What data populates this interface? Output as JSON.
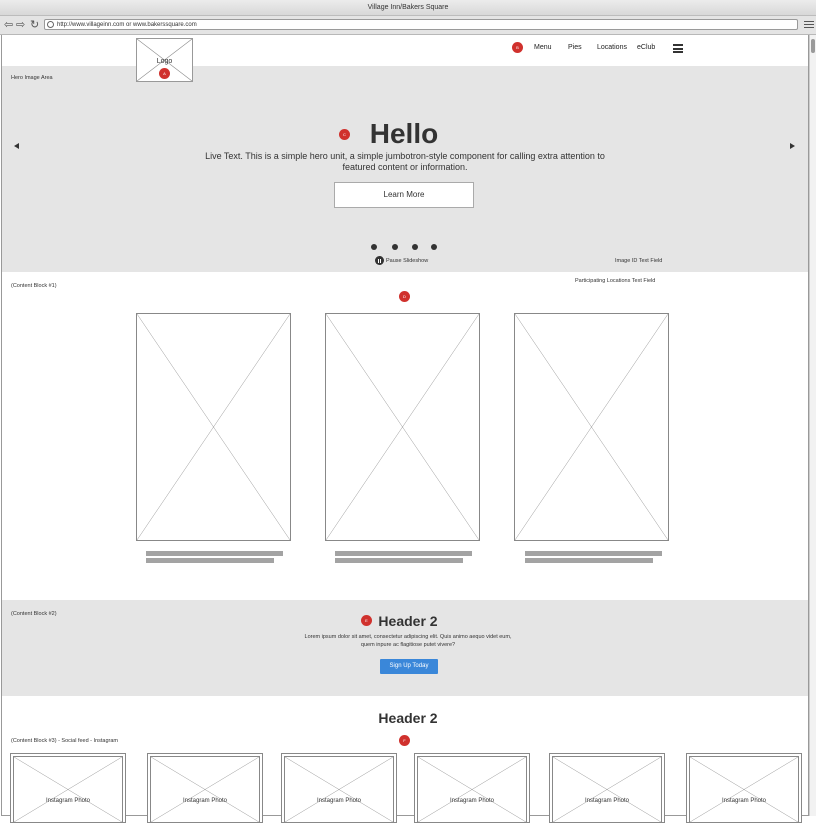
{
  "window": {
    "title": "Village Inn/Bakers Square"
  },
  "toolbar": {
    "back": "⇦",
    "forward": "⇨",
    "reload": "↻",
    "url": "http://www.villageinn.com or www.bakerssquare.com"
  },
  "header": {
    "logo_label": "Logo",
    "nav": [
      "Menu",
      "Pies",
      "Locations",
      "eClub"
    ]
  },
  "markers": [
    "A",
    "B",
    "C",
    "D",
    "E",
    "F"
  ],
  "hero": {
    "area_label": "Hero Image Area",
    "title": "Hello",
    "body": "Live Text. This is a simple hero unit, a simple jumbotron-style component for calling extra attention to featured content or information.",
    "button": "Learn More",
    "slides": 4,
    "pause_label": "Pause Slideshow",
    "image_id_label": "Image ID Text Field"
  },
  "block1": {
    "label": "(Content Block #1)",
    "locations_label": "Participating Locations Text Field"
  },
  "block2": {
    "label": "(Content Block #2)",
    "title": "Header 2",
    "body": "Lorem ipsum dolor sit amet, consectetur adipiscing elit. Quis animo aequo videt eum, quem inpure ac flagitiose putet vivere?",
    "button": "Sign Up Today"
  },
  "block3": {
    "title": "Header 2",
    "label": "(Content Block #3) - Social feed - Instagram",
    "photo_label": "Instagram Photo"
  },
  "colors": {
    "accent": "#3a87d9",
    "marker": "#d0312d",
    "band": "#e5e5e5"
  }
}
